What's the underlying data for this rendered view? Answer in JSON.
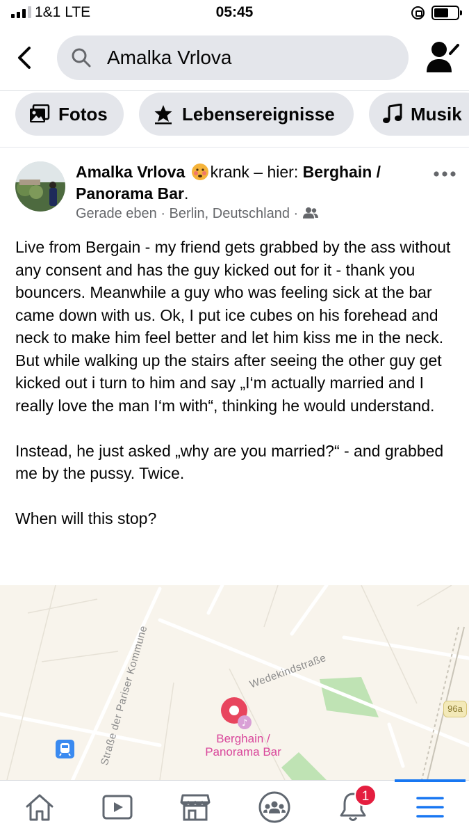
{
  "status_bar": {
    "carrier": "1&1  LTE",
    "time": "05:45",
    "battery_level": 0.62
  },
  "search": {
    "query": "Amalka Vrlova"
  },
  "chips": [
    {
      "label": "Fotos",
      "icon": "photos-icon"
    },
    {
      "label": "Lebensereignisse",
      "icon": "star-icon"
    },
    {
      "label": "Musik",
      "icon": "music-note-icon"
    }
  ],
  "post": {
    "author": "Amalka Vrlova",
    "feeling_emoji": "sick-face-emoji",
    "feeling": "krank – hier: ",
    "place": "Berghain / Panorama Bar",
    "place_suffix": ".",
    "time": "Gerade eben",
    "location": "Berlin, Deutschland",
    "audience_icon": "friends-icon",
    "paragraphs": [
      "Live from Bergain - my friend gets grabbed by the ass without any consent and has the guy kicked out for it - thank you bouncers. Meanwhile a guy who was feeling sick at the bar came down with us. Ok, I put ice cubes on his forehead and neck to make him feel better and let him kiss me in the neck. But while walking up the stairs after seeing the other guy get kicked out i turn to him and say „I‘m actually married and I really love the man I‘m with“,  thinking he would understand.",
      "Instead, he just asked „why are you married?“ - and grabbed me by the pussy. Twice.",
      "When will this stop?"
    ]
  },
  "map": {
    "streets": [
      "Straße der Pariser Kommune",
      "Wedekindstraße"
    ],
    "place_label_line1": "Berghain /",
    "place_label_line2": "Panorama Bar",
    "road_number": "96a",
    "colors": {
      "background": "#f8f4ec",
      "park": "#bfe3b4",
      "pin": "#e8455e",
      "label": "#d9479b"
    }
  },
  "nav": {
    "items": [
      "home-icon",
      "video-icon",
      "marketplace-icon",
      "groups-icon",
      "notifications-icon",
      "menu-icon"
    ],
    "notification_count": "1",
    "accent": "#1877f2"
  }
}
